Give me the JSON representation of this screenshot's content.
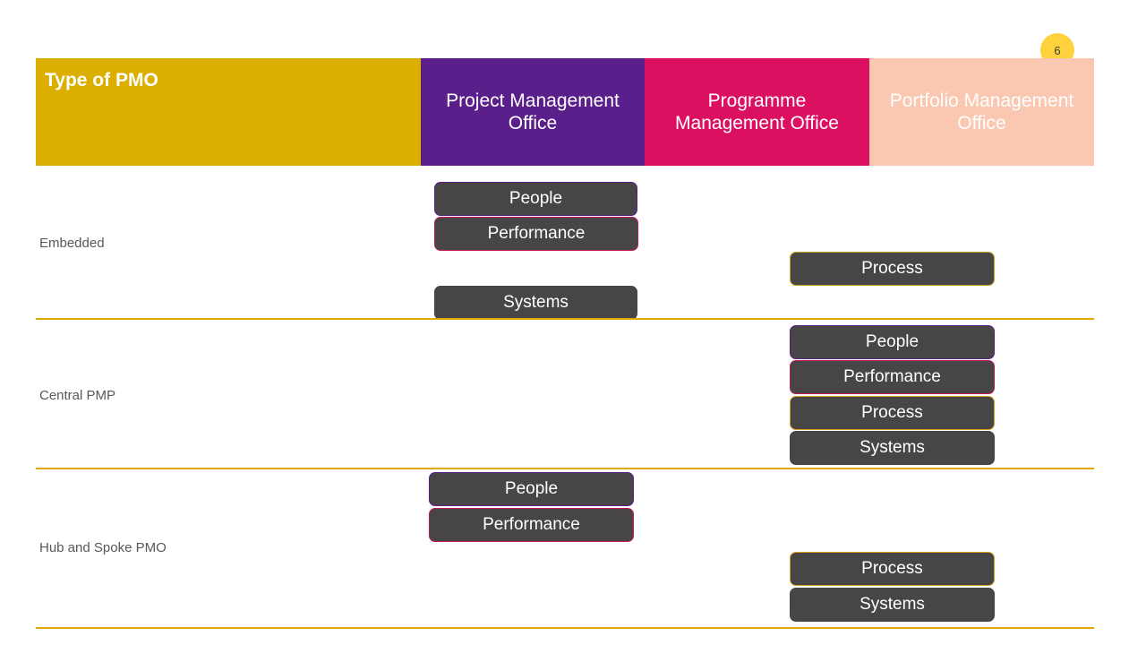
{
  "slide": {
    "page_number": "6",
    "colors": {
      "gold": "#DCAE00",
      "purple": "#5B1F8C",
      "pink": "#DC1060",
      "salmon": "#FAC7B0",
      "box_fill": "#474546",
      "rule": "#E0A800",
      "badge": "#FFD13B"
    }
  },
  "header": {
    "title": "Type of PMO",
    "columns": [
      {
        "label": "Project Management Office",
        "key": "project"
      },
      {
        "label": "Programme Management Office",
        "key": "programme"
      },
      {
        "label": "Portfolio Management Office",
        "key": "portfolio"
      }
    ]
  },
  "rows": [
    {
      "label": "Embedded",
      "project": [
        "People",
        "Performance",
        "Systems"
      ],
      "programme": [],
      "portfolio": [
        "Process"
      ]
    },
    {
      "label": "Central PMP",
      "project": [],
      "programme": [],
      "portfolio": [
        "People",
        "Performance",
        "Process",
        "Systems"
      ]
    },
    {
      "label": "Hub and Spoke PMO",
      "project": [
        "People",
        "Performance"
      ],
      "programme": [],
      "portfolio": [
        "Process",
        "Systems"
      ]
    }
  ],
  "capabilities": {
    "people": "People",
    "performance": "Performance",
    "process": "Process",
    "systems": "Systems"
  }
}
